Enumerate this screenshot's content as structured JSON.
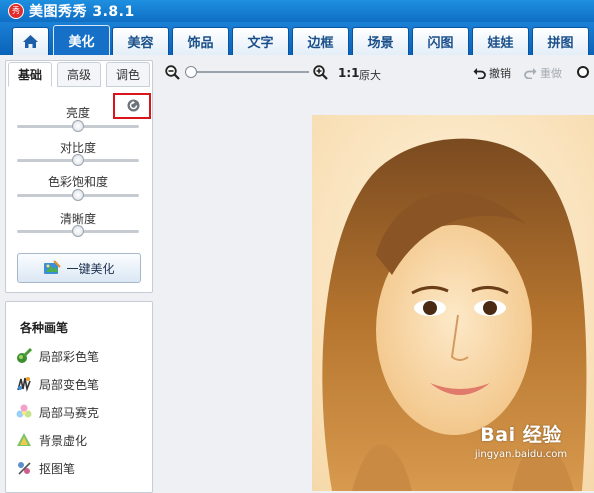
{
  "window": {
    "title": "美图秀秀 3.8.1",
    "logo_text": "秀"
  },
  "tabs": [
    {
      "label": "美化",
      "active": true
    },
    {
      "label": "美容",
      "active": false
    },
    {
      "label": "饰品",
      "active": false
    },
    {
      "label": "文字",
      "active": false
    },
    {
      "label": "边框",
      "active": false
    },
    {
      "label": "场景",
      "active": false
    },
    {
      "label": "闪图",
      "active": false
    },
    {
      "label": "娃娃",
      "active": false
    },
    {
      "label": "拼图",
      "active": false
    }
  ],
  "subtabs": [
    {
      "label": "基础",
      "active": true
    },
    {
      "label": "高级",
      "active": false
    },
    {
      "label": "调色",
      "active": false
    }
  ],
  "adjustments": [
    {
      "label": "亮度",
      "value": 0.5
    },
    {
      "label": "对比度",
      "value": 0.5
    },
    {
      "label": "色彩饱和度",
      "value": 0.5
    },
    {
      "label": "清晰度",
      "value": 0.5
    }
  ],
  "beautify_button": {
    "label": "一键美化"
  },
  "brushes": {
    "title": "各种画笔",
    "items": [
      {
        "label": "局部彩色笔",
        "icon": "color-brush-icon"
      },
      {
        "label": "局部变色笔",
        "icon": "recolor-brush-icon"
      },
      {
        "label": "局部马赛克",
        "icon": "mosaic-brush-icon"
      },
      {
        "label": "背景虚化",
        "icon": "blur-background-icon"
      },
      {
        "label": "抠图笔",
        "icon": "cutout-brush-icon"
      }
    ]
  },
  "toolbar": {
    "zoom_ratio_label": "1:1",
    "zoom_actual_label": "原大",
    "zoom_level": 0.0,
    "undo_label": "撤销",
    "redo_label": "重做"
  },
  "watermark": {
    "brand": "Bai 经验",
    "url": "jingyan.baidu.com"
  },
  "colors": {
    "title_blue": "#1e8fe0",
    "highlight_red": "#d9141a",
    "accent_blue": "#1670c8"
  }
}
